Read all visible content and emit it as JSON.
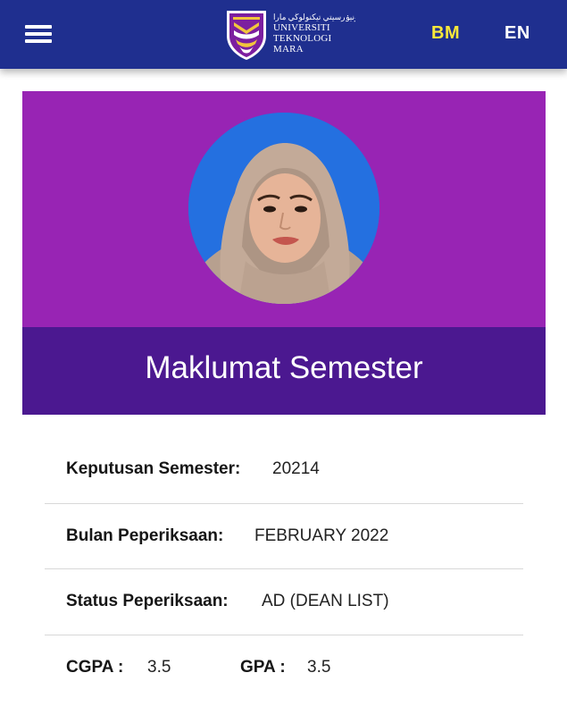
{
  "header": {
    "menu_icon": "hamburger-menu-icon",
    "logo": {
      "jawi": "اونيۏرسيتي تيكنولوڬي مارا",
      "line1": "UNIVERSITI",
      "line2": "TEKNOLOGI",
      "line3": "MARA"
    },
    "lang_bm": "BM",
    "lang_en": "EN",
    "colors": {
      "bar": "#1f2f8f",
      "active_lang": "#f7e83a"
    }
  },
  "profile_card": {
    "title": "Maklumat Semester",
    "colors": {
      "top": "#9824b4",
      "bottom": "#4b1890",
      "avatar_bg": "#2470e0"
    }
  },
  "details": {
    "semester_label": "Keputusan Semester:",
    "semester_value": "20214",
    "exam_month_label": "Bulan Peperiksaan:",
    "exam_month_value": "FEBRUARY 2022",
    "exam_status_label": "Status Peperiksaan:",
    "exam_status_value": "AD (DEAN LIST)",
    "cgpa_label": "CGPA :",
    "cgpa_value": "3.5",
    "gpa_label": "GPA :",
    "gpa_value": "3.5"
  }
}
